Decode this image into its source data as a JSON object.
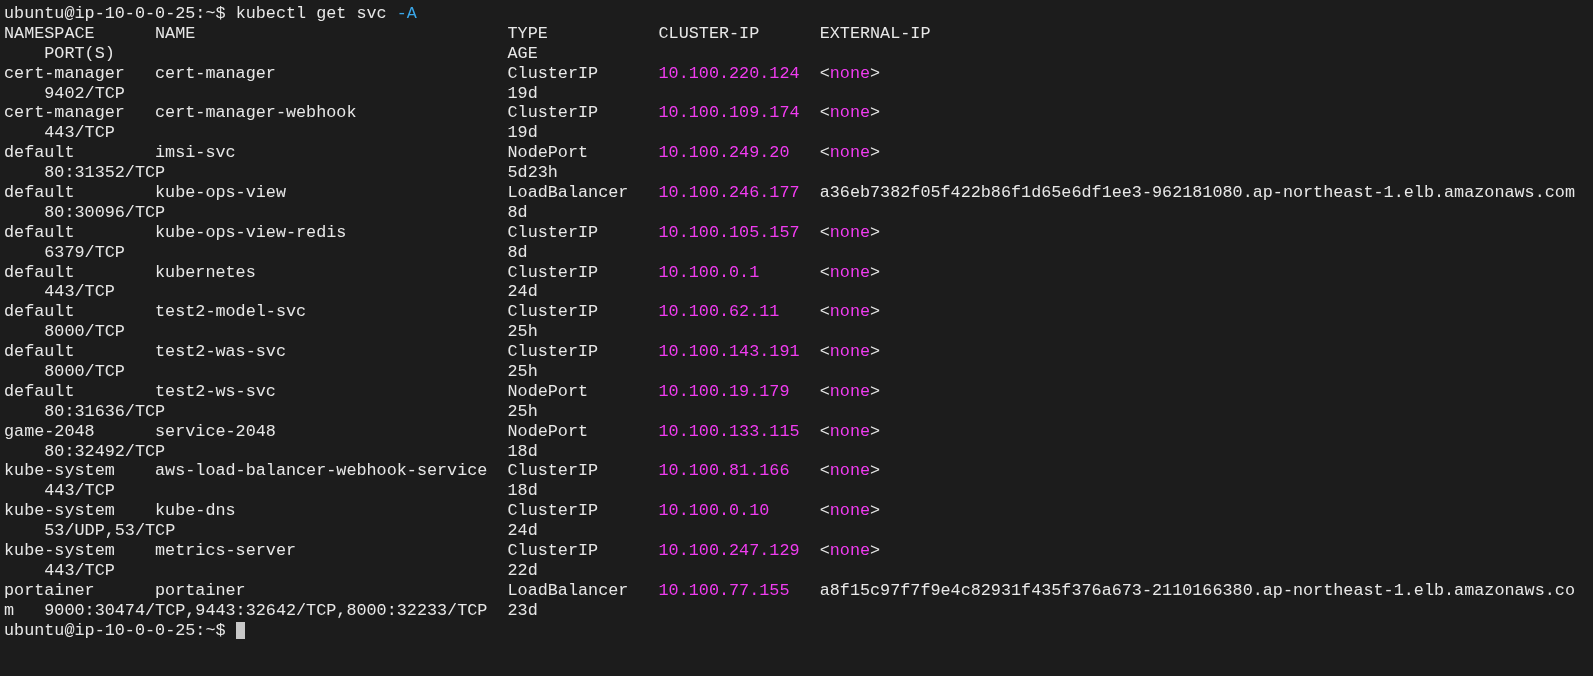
{
  "prompt": {
    "user_host": "ubuntu@ip-10-0-0-25:~$",
    "command": "kubectl get svc",
    "flag": "-A"
  },
  "header": {
    "namespace": "NAMESPACE",
    "name": "NAME",
    "type": "TYPE",
    "cluster_ip": "CLUSTER-IP",
    "external_ip": "EXTERNAL-IP",
    "ports": "PORT(S)",
    "age": "AGE"
  },
  "rows": [
    {
      "namespace": "cert-manager",
      "name": "cert-manager",
      "type": "ClusterIP",
      "cluster_ip": "10.100.220.124",
      "external_ip": "<none>",
      "highlighted": true,
      "ports": "9402/TCP",
      "age": "19d"
    },
    {
      "namespace": "cert-manager",
      "name": "cert-manager-webhook",
      "type": "ClusterIP",
      "cluster_ip": "10.100.109.174",
      "external_ip": "<none>",
      "highlighted": true,
      "ports": "443/TCP",
      "age": "19d"
    },
    {
      "namespace": "default",
      "name": "imsi-svc",
      "type": "NodePort",
      "cluster_ip": "10.100.249.20",
      "external_ip": "<none>",
      "highlighted": true,
      "ports": "80:31352/TCP",
      "age": "5d23h"
    },
    {
      "namespace": "default",
      "name": "kube-ops-view",
      "type": "LoadBalancer",
      "cluster_ip": "10.100.246.177",
      "external_ip": "a36eb7382f05f422b86f1d65e6df1ee3-962181080.ap-northeast-1.elb.amazonaws.com",
      "highlighted": false,
      "ports": "80:30096/TCP",
      "age": "8d"
    },
    {
      "namespace": "default",
      "name": "kube-ops-view-redis",
      "type": "ClusterIP",
      "cluster_ip": "10.100.105.157",
      "external_ip": "<none>",
      "highlighted": true,
      "ports": "6379/TCP",
      "age": "8d"
    },
    {
      "namespace": "default",
      "name": "kubernetes",
      "type": "ClusterIP",
      "cluster_ip": "10.100.0.1",
      "external_ip": "<none>",
      "highlighted": true,
      "ports": "443/TCP",
      "age": "24d"
    },
    {
      "namespace": "default",
      "name": "test2-model-svc",
      "type": "ClusterIP",
      "cluster_ip": "10.100.62.11",
      "external_ip": "<none>",
      "highlighted": true,
      "ports": "8000/TCP",
      "age": "25h"
    },
    {
      "namespace": "default",
      "name": "test2-was-svc",
      "type": "ClusterIP",
      "cluster_ip": "10.100.143.191",
      "external_ip": "<none>",
      "highlighted": true,
      "ports": "8000/TCP",
      "age": "25h"
    },
    {
      "namespace": "default",
      "name": "test2-ws-svc",
      "type": "NodePort",
      "cluster_ip": "10.100.19.179",
      "external_ip": "<none>",
      "highlighted": true,
      "ports": "80:31636/TCP",
      "age": "25h"
    },
    {
      "namespace": "game-2048",
      "name": "service-2048",
      "type": "NodePort",
      "cluster_ip": "10.100.133.115",
      "external_ip": "<none>",
      "highlighted": true,
      "ports": "80:32492/TCP",
      "age": "18d"
    },
    {
      "namespace": "kube-system",
      "name": "aws-load-balancer-webhook-service",
      "type": "ClusterIP",
      "cluster_ip": "10.100.81.166",
      "external_ip": "<none>",
      "highlighted": true,
      "ports": "443/TCP",
      "age": "18d"
    },
    {
      "namespace": "kube-system",
      "name": "kube-dns",
      "type": "ClusterIP",
      "cluster_ip": "10.100.0.10",
      "external_ip": "<none>",
      "highlighted": true,
      "ports": "53/UDP,53/TCP",
      "age": "24d"
    },
    {
      "namespace": "kube-system",
      "name": "metrics-server",
      "type": "ClusterIP",
      "cluster_ip": "10.100.247.129",
      "external_ip": "<none>",
      "highlighted": true,
      "ports": "443/TCP",
      "age": "22d"
    },
    {
      "namespace": "portainer",
      "name": "portainer",
      "type": "LoadBalancer",
      "cluster_ip": "10.100.77.155",
      "external_ip": "a8f15c97f7f9e4c82931f435f376a673-2110166380.ap-northeast-1.elb.amazonaws.co",
      "highlighted": false,
      "wrapped": "m",
      "ports": "9000:30474/TCP,9443:32642/TCP,8000:32233/TCP",
      "age": "23d"
    }
  ],
  "final_prompt": {
    "user_host": "ubuntu@ip-10-0-0-25:~$"
  }
}
